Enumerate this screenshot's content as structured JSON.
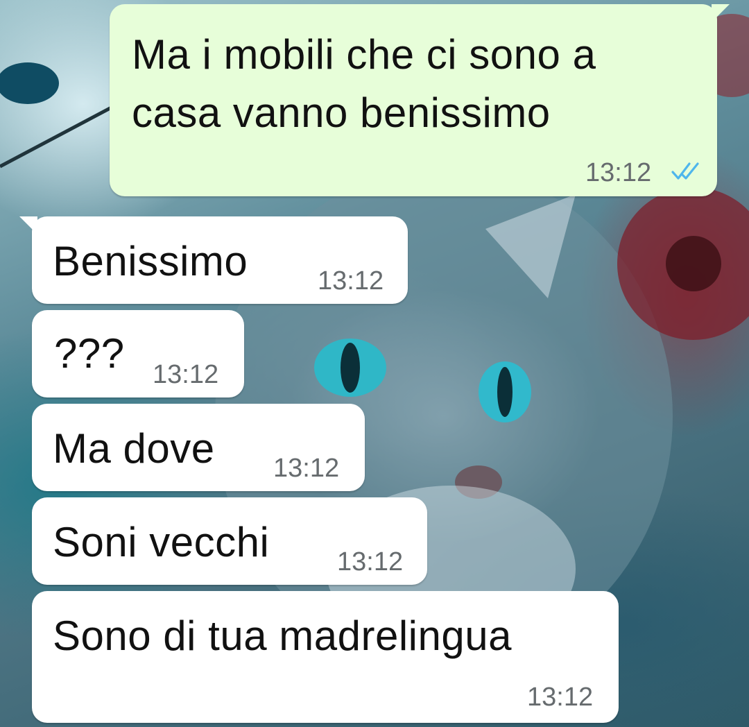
{
  "chat": {
    "messages": [
      {
        "direction": "outgoing",
        "lines": [
          "Ma i mobili che ci sono a",
          "casa vanno benissimo"
        ],
        "time": "13:12",
        "status": "read",
        "status_icon": "double-check-icon"
      },
      {
        "direction": "incoming",
        "text": "Benissimo",
        "time": "13:12"
      },
      {
        "direction": "incoming",
        "text": "???",
        "time": "13:12"
      },
      {
        "direction": "incoming",
        "text": "Ma dove",
        "time": "13:12"
      },
      {
        "direction": "incoming",
        "text": "Soni vecchi",
        "time": "13:12"
      },
      {
        "direction": "incoming",
        "text": "Sono di tua madrelingua",
        "time": "13:12"
      }
    ]
  },
  "colors": {
    "outgoing_bubble": "#e7fed9",
    "incoming_bubble": "#ffffff",
    "read_ticks": "#4fb6ec",
    "timestamp": "#666b6e"
  }
}
